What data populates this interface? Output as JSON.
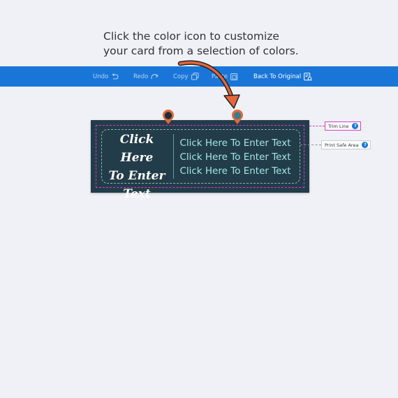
{
  "instruction": {
    "line1": "Click the color icon to customize",
    "line2": "your card from a selection of colors."
  },
  "toolbar": {
    "undo_label": "Undo",
    "redo_label": "Redo",
    "copy_label": "Copy",
    "paste_label": "Paste",
    "back_label": "Back To Original",
    "background_color": "#1976d8"
  },
  "card": {
    "background_color": "#233c49",
    "script_lines": [
      "Click Here",
      "To Enter",
      "Text"
    ],
    "text_lines": [
      "Click Here To Enter Text",
      "Click Here To Enter Text",
      "Click Here To Enter Text"
    ],
    "text_color": "#9fe7ea",
    "pin_left_color": "#1a2f3b",
    "pin_right_color": "#3a7d8c",
    "pin_ring_color": "#e0683a"
  },
  "guides": {
    "trim_line": "Trim Line",
    "print_safe_area": "Print Safe Area",
    "help_glyph": "?"
  },
  "icons": [
    "undo-icon",
    "redo-icon",
    "copy-icon",
    "paste-icon",
    "back-to-original-icon",
    "help-icon",
    "color-pin-icon",
    "curved-arrow"
  ]
}
